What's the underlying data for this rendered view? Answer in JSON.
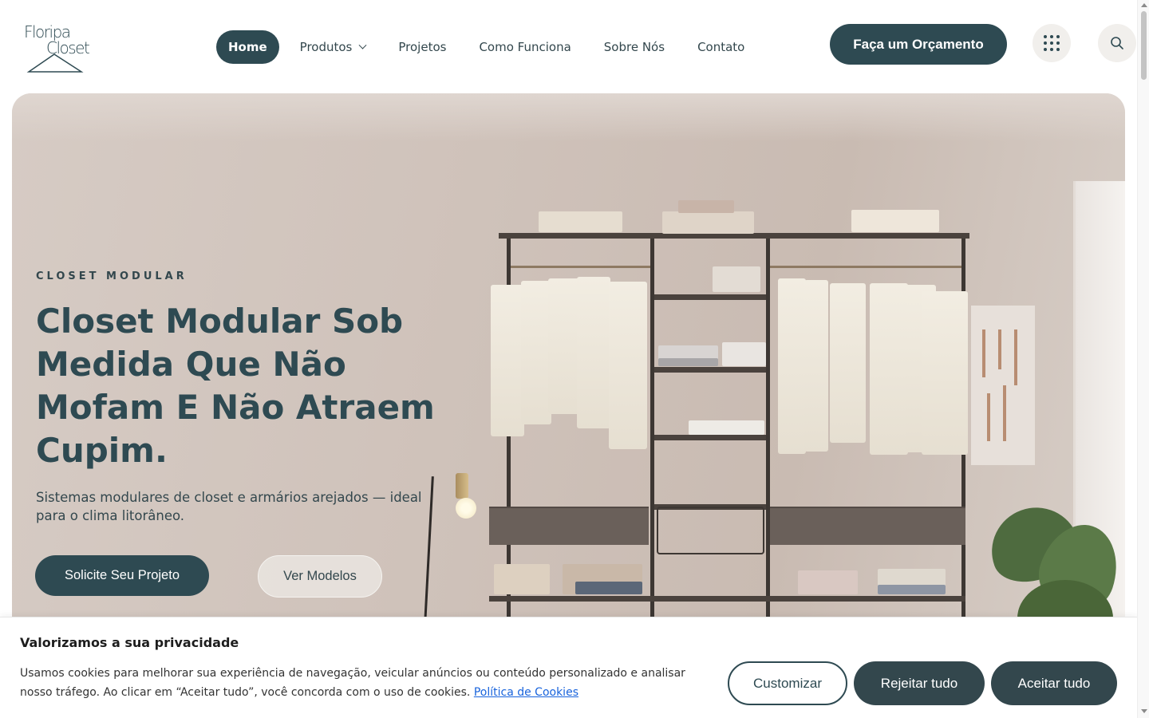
{
  "brand": {
    "logo_line1": "Floripa",
    "logo_line2": "Closet"
  },
  "nav": {
    "items": [
      {
        "label": "Home",
        "active": true
      },
      {
        "label": "Produtos",
        "has_dropdown": true
      },
      {
        "label": "Projetos"
      },
      {
        "label": "Como Funciona"
      },
      {
        "label": "Sobre Nós"
      },
      {
        "label": "Contato"
      }
    ],
    "cta_label": "Faça um Orçamento",
    "apps_icon": "grid-dots-icon",
    "search_icon": "search-icon"
  },
  "hero": {
    "eyebrow": "CLOSET MODULAR",
    "title": "Closet Modular Sob Medida Que Não Mofam E Não Atraem Cupim.",
    "subtitle": "Sistemas modulares de closet e armários arejados — ideal para o clima litorâneo.",
    "primary_button": "Solicite Seu Projeto",
    "secondary_button": "Ver Modelos"
  },
  "cookie_banner": {
    "title": "Valorizamos a sua privacidade",
    "text": "Usamos cookies para melhorar sua experiência de navegação, veicular anúncios ou conteúdo personalizado e analisar nosso tráfego. Ao clicar em “Aceitar tudo”, você concorda com o uso de cookies.",
    "policy_link": "Política de Cookies",
    "customize": "Customizar",
    "reject": "Rejeitar tudo",
    "accept": "Aceitar tudo"
  },
  "colors": {
    "primary": "#2e4a52",
    "text": "#33474d",
    "link": "#1863dc",
    "chip_bg": "#f1efec"
  }
}
